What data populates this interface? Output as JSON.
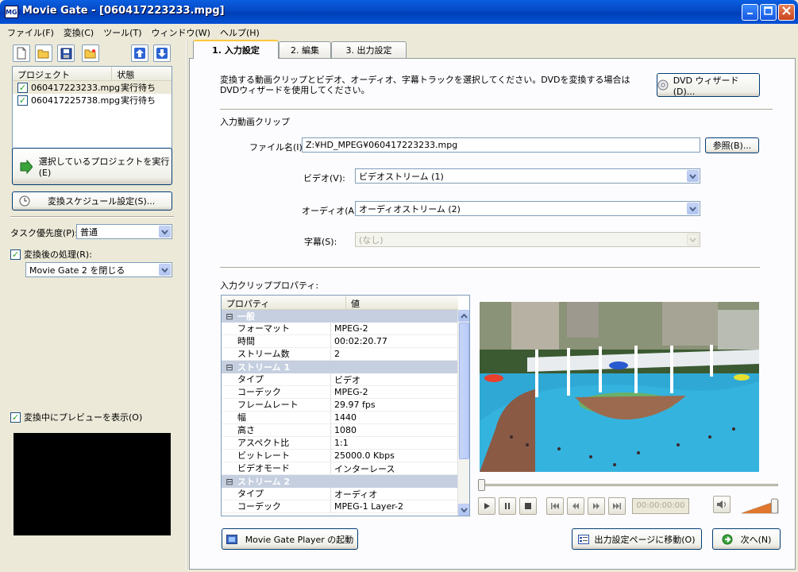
{
  "window": {
    "title": "Movie Gate - [060417223233.mpg]",
    "app_icon_text": "MG2"
  },
  "menu": [
    "ファイル(F)",
    "変換(C)",
    "ツール(T)",
    "ウィンドウ(W)",
    "ヘルプ(H)"
  ],
  "project_list": {
    "columns": [
      "プロジェクト",
      "状態"
    ],
    "rows": [
      {
        "name": "060417223233.mpg",
        "status": "実行待ち"
      },
      {
        "name": "060417225738.mpg",
        "status": "実行待ち"
      }
    ]
  },
  "run_selected_label": "選択しているプロジェクトを実行(E)",
  "schedule_label": "変換スケジュール設定(S)...",
  "task_priority": {
    "label": "タスク優先度(P):",
    "value": "普通"
  },
  "post_process": {
    "label": "変換後の処理(R):",
    "value": "Movie Gate 2 を閉じる"
  },
  "preview_label": "変換中にプレビューを表示(O)",
  "tabs": [
    "1. 入力設定",
    "2. 編集",
    "3. 出力設定"
  ],
  "description": "変換する動画クリップとビデオ、オーディオ、字幕トラックを選択してください。DVDを変換する場合はDVDウィザードを使用してください。",
  "dvd_wizard_label": "DVD ウィザード(D)...",
  "input_clip_section": "入力動画クリップ",
  "file_name": {
    "label": "ファイル名(I):",
    "value": "Z:¥HD_MPEG¥060417223233.mpg",
    "browse_label": "参照(B)..."
  },
  "video": {
    "label": "ビデオ(V):",
    "value": "ビデオストリーム (1)"
  },
  "audio": {
    "label": "オーディオ(A):",
    "value": "オーディオストリーム (2)"
  },
  "subtitle": {
    "label": "字幕(S):",
    "value": "(なし)"
  },
  "properties_section": "入力クリッププロパティ:",
  "properties": {
    "columns": [
      "プロパティ",
      "値"
    ],
    "groups": [
      {
        "name": "一般",
        "items": [
          [
            "フォーマット",
            "MPEG-2"
          ],
          [
            "時間",
            "00:02:20.77"
          ],
          [
            "ストリーム数",
            "2"
          ]
        ]
      },
      {
        "name": "ストリーム 1",
        "items": [
          [
            "タイプ",
            "ビデオ"
          ],
          [
            "コーデック",
            "MPEG-2"
          ],
          [
            "フレームレート",
            "29.97 fps"
          ],
          [
            "幅",
            "1440"
          ],
          [
            "高さ",
            "1080"
          ],
          [
            "アスペクト比",
            "1:1"
          ],
          [
            "ビットレート",
            "25000.0 Kbps"
          ],
          [
            "ビデオモード",
            "インターレース"
          ]
        ]
      },
      {
        "name": "ストリーム 2",
        "items": [
          [
            "タイプ",
            "オーディオ"
          ],
          [
            "コーデック",
            "MPEG-1 Layer-2"
          ]
        ]
      }
    ]
  },
  "player": {
    "timecode": "00:00:00:00",
    "volume_fraction": 0.9
  },
  "player_launch_label": "Movie Gate Player の起動",
  "goto_output_label": "出力設定ページに移動(O)",
  "next_label": "次へ(N)",
  "colors": {
    "titlebar": "#0548c4",
    "tab_active_accent": "#ffc83c",
    "pool_water": "#2fa8d6"
  }
}
